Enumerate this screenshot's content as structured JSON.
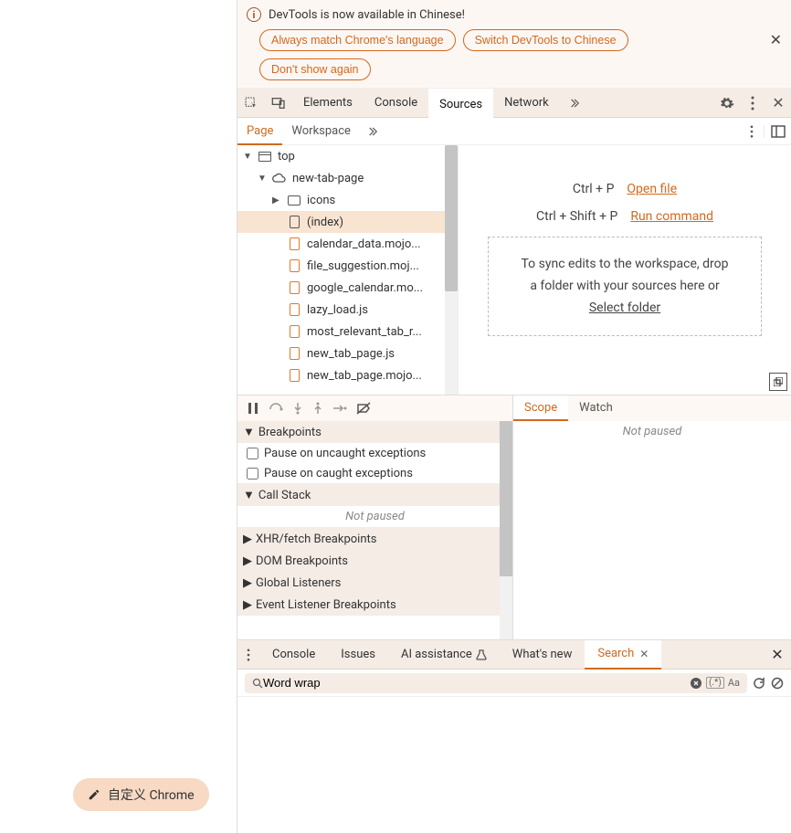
{
  "customize": {
    "label": "自定义 Chrome"
  },
  "infobar": {
    "message": "DevTools is now available in Chinese!",
    "btn_match": "Always match Chrome's language",
    "btn_switch": "Switch DevTools to Chinese",
    "btn_dismiss": "Don't show again"
  },
  "main_tabs": {
    "elements": "Elements",
    "console": "Console",
    "sources": "Sources",
    "network": "Network"
  },
  "sub_tabs": {
    "page": "Page",
    "workspace": "Workspace"
  },
  "tree": {
    "top": "top",
    "ntp": "new-tab-page",
    "icons": "icons",
    "index": "(index)",
    "files": [
      "calendar_data.mojo...",
      "file_suggestion.moj...",
      "google_calendar.mo...",
      "lazy_load.js",
      "most_relevant_tab_r...",
      "new_tab_page.js",
      "new_tab_page.mojo..."
    ]
  },
  "shortcuts": {
    "open_keys": "Ctrl + P",
    "open_label": "Open file",
    "cmd_keys": "Ctrl + Shift + P",
    "cmd_label": "Run command"
  },
  "dropbox": {
    "line1": "To sync edits to the workspace, drop",
    "line2": "a folder with your sources here or",
    "select": "Select folder"
  },
  "debug_tabs": {
    "scope": "Scope",
    "watch": "Watch"
  },
  "not_paused": "Not paused",
  "sections": {
    "breakpoints": "Breakpoints",
    "pause_uncaught": "Pause on uncaught exceptions",
    "pause_caught": "Pause on caught exceptions",
    "callstack": "Call Stack",
    "xhr": "XHR/fetch Breakpoints",
    "dom": "DOM Breakpoints",
    "global": "Global Listeners",
    "event": "Event Listener Breakpoints"
  },
  "bottom_tabs": {
    "console": "Console",
    "issues": "Issues",
    "ai": "AI assistance",
    "whatsnew": "What's new",
    "search": "Search"
  },
  "search": {
    "value": "Word wrap"
  }
}
